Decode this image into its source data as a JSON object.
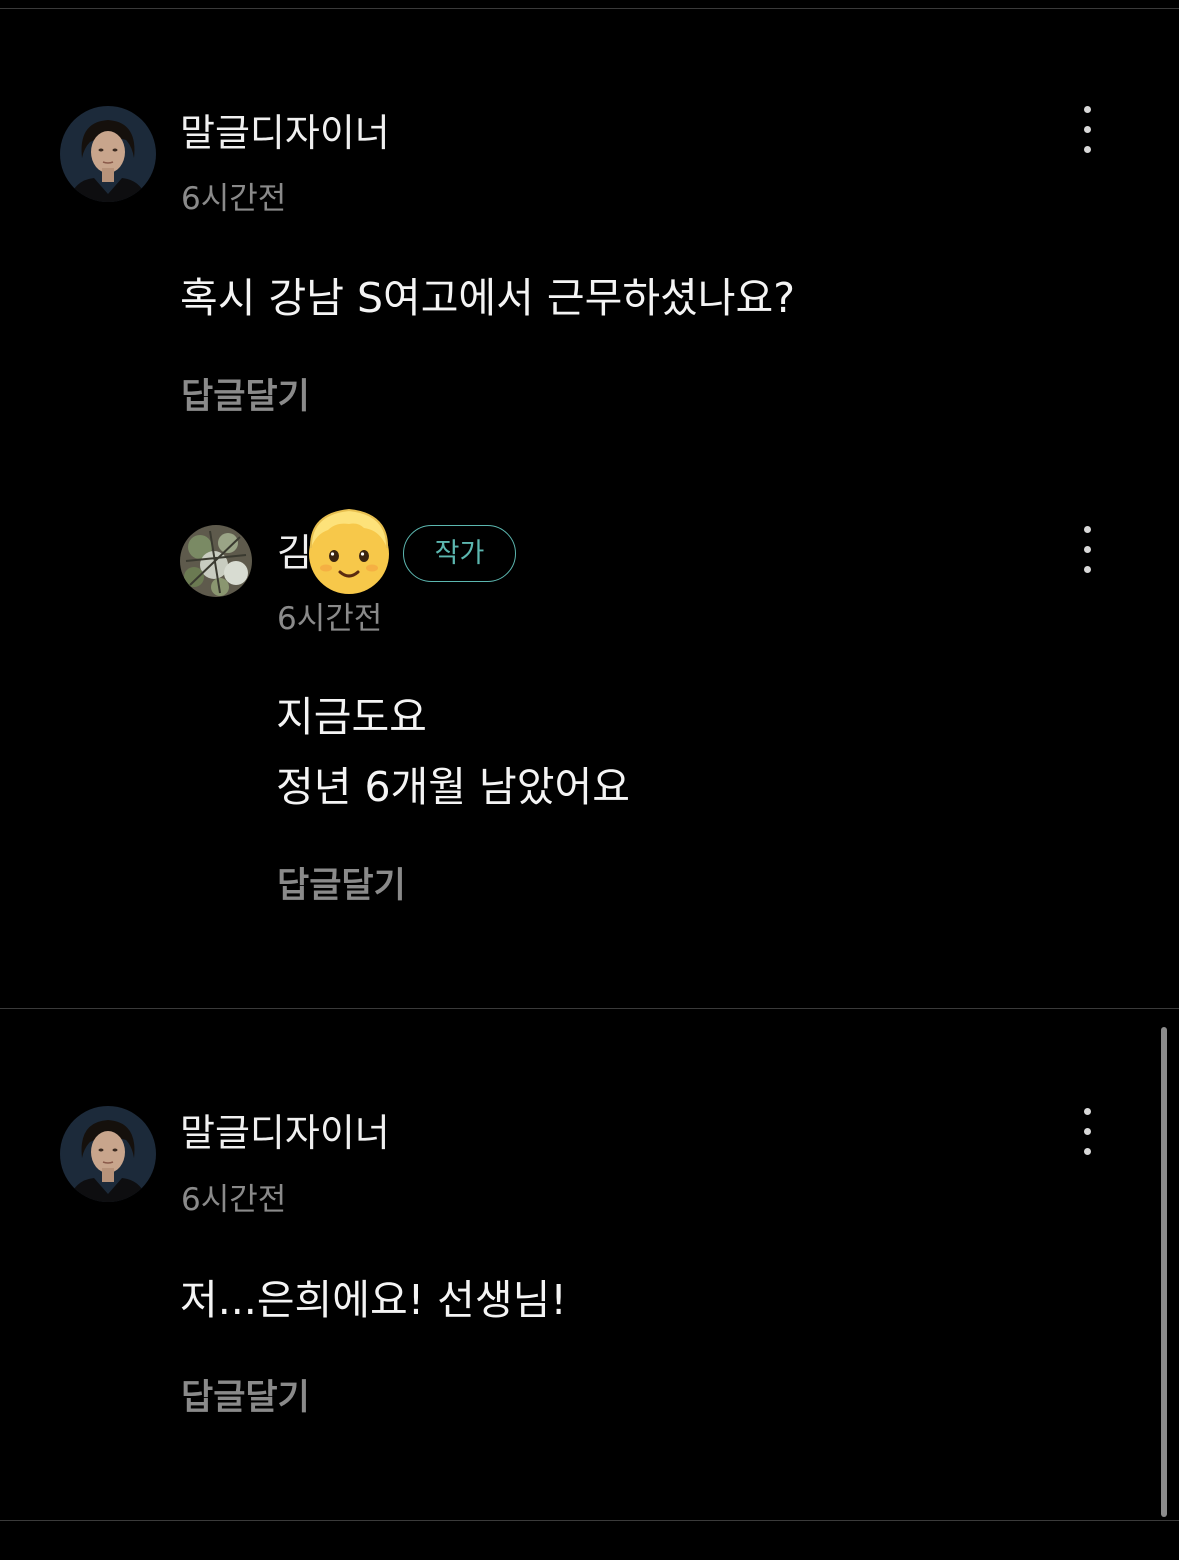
{
  "comments": [
    {
      "author": "말글디자이너",
      "time": "6시간전",
      "text": "혹시 강남 S여고에서 근무하셨나요?",
      "reply_label": "답글달기",
      "avatar": "portrait-woman-avatar",
      "more_icon": "more-vertical-icon"
    },
    {
      "author": "김",
      "badge": "작가",
      "time": "6시간전",
      "text_lines": [
        "지금도요",
        "정년 6개월 남았어요"
      ],
      "reply_label": "답글달기",
      "avatar": "plant-photo-avatar",
      "overlay_icon": "child-face-emoji-icon",
      "more_icon": "more-vertical-icon"
    },
    {
      "author": "말글디자이너",
      "time": "6시간전",
      "text": "저...은희에요! 선생님!",
      "reply_label": "답글달기",
      "avatar": "portrait-woman-avatar",
      "more_icon": "more-vertical-icon"
    }
  ],
  "colors": {
    "background": "#000000",
    "text": "#f4f4f4",
    "muted": "#8a8a8a",
    "badge": "#5cb7b0",
    "divider": "#3a3a3a"
  }
}
